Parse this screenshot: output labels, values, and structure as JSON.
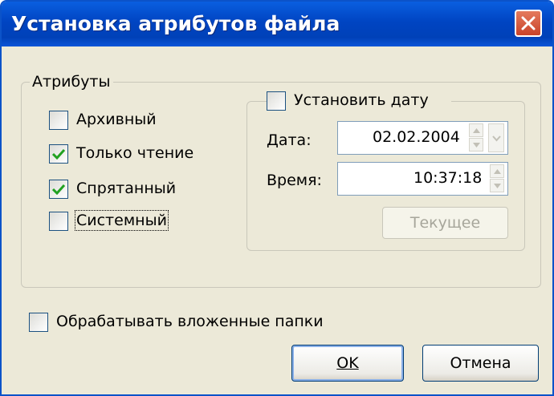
{
  "window": {
    "title": "Установка атрибутов файла",
    "close_icon": "close-x-icon"
  },
  "attributes": {
    "group_label": "Атрибуты",
    "items": [
      {
        "label": "Архивный",
        "checked": false
      },
      {
        "label": "Только чтение",
        "checked": true
      },
      {
        "label": "Спрятанный",
        "checked": true
      },
      {
        "label": "Системный",
        "checked": false
      }
    ]
  },
  "date_group": {
    "set_date_label": "Установить дату",
    "set_date_checked": false,
    "date_label": "Дата:",
    "date_value": "02.02.2004",
    "time_label": "Время:",
    "time_value": "10:37:18",
    "current_button": "Текущее"
  },
  "process_subfolders": {
    "label": "Обрабатывать вложенные папки",
    "checked": false
  },
  "buttons": {
    "ok": "OK",
    "cancel": "Отмена"
  },
  "colors": {
    "titlebar": "#0a5fe0",
    "close_button": "#d65a3e",
    "dialog_background": "#ece9d8",
    "checkmark": "#21a121"
  }
}
